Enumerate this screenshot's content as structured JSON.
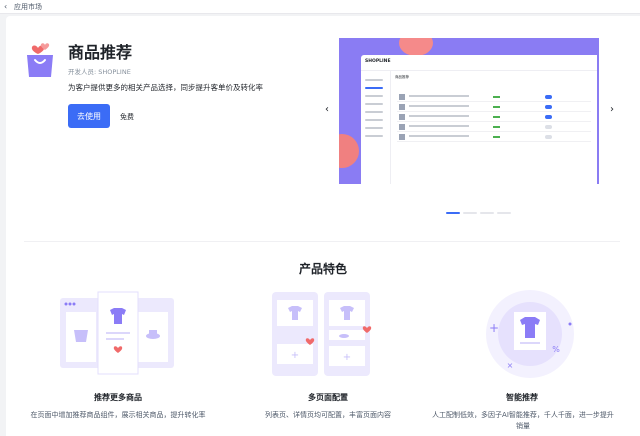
{
  "breadcrumb": {
    "back_glyph": "‹",
    "label": "应用市场"
  },
  "app": {
    "title": "商品推荐",
    "developer": "开发人员: SHOPLINE",
    "description": "为客户提供更多的相关产品选择，同步提升客单价及转化率",
    "install_label": "去使用",
    "price_label": "免费"
  },
  "carousel": {
    "prev_glyph": "‹",
    "next_glyph": "›",
    "active_index": 0,
    "slide_count": 4,
    "mock": {
      "logo": "SHOPLINE",
      "heading": "商品推荐"
    }
  },
  "features": {
    "title": "产品特色",
    "items": [
      {
        "name": "推荐更多商品",
        "desc": "在页面中增加推荐商品组件，展示相关商品，提升转化率"
      },
      {
        "name": "多页面配置",
        "desc": "列表页、详情页均可配置，丰富页面内容"
      },
      {
        "name": "智能推荐",
        "desc": "人工配制低效，多因子AI智能推荐，千人千面，进一步提升销量"
      }
    ]
  },
  "colors": {
    "accent": "#3b6cf6",
    "banner": "#8a7cf3",
    "icon_purple": "#8b7cf6",
    "heart": "#f06a6a"
  }
}
